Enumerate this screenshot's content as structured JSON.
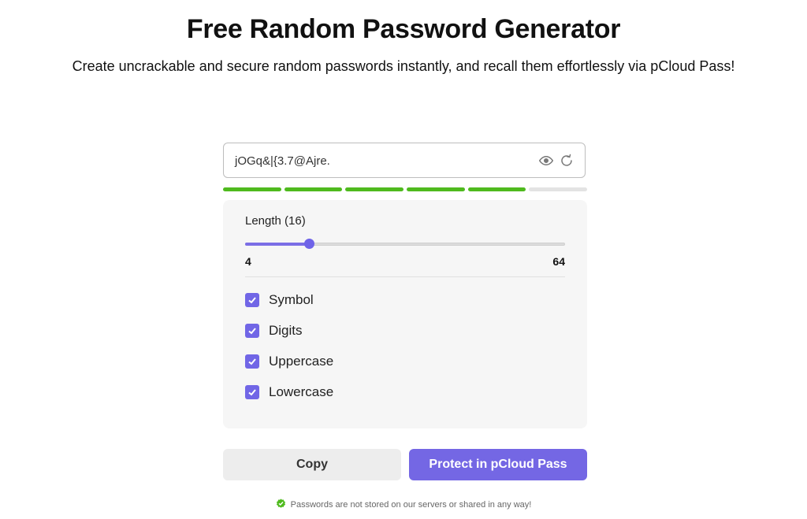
{
  "header": {
    "title": "Free Random Password Generator",
    "subtitle": "Create uncrackable and secure random passwords instantly, and recall them effortlessly via pCloud Pass!"
  },
  "password": {
    "value": "jOGq&|{3.7@Ajre.",
    "icons": [
      "eye-icon",
      "refresh-icon"
    ]
  },
  "strength": {
    "segments_total": 6,
    "segments_filled": 5,
    "color_on": "#4fba1e",
    "color_off": "#e3e3e3"
  },
  "length": {
    "label": "Length (16)",
    "value": 16,
    "min": 4,
    "max": 64,
    "min_label": "4",
    "max_label": "64"
  },
  "options": [
    {
      "label": "Symbol",
      "checked": true
    },
    {
      "label": "Digits",
      "checked": true
    },
    {
      "label": "Uppercase",
      "checked": true
    },
    {
      "label": "Lowercase",
      "checked": true
    }
  ],
  "buttons": {
    "copy": "Copy",
    "protect": "Protect in pCloud Pass"
  },
  "notice": {
    "text": "Passwords are not stored on our servers or shared in any way!",
    "icon": "check-shield-icon"
  },
  "colors": {
    "accent": "#7467e4",
    "success": "#4fba1e"
  }
}
